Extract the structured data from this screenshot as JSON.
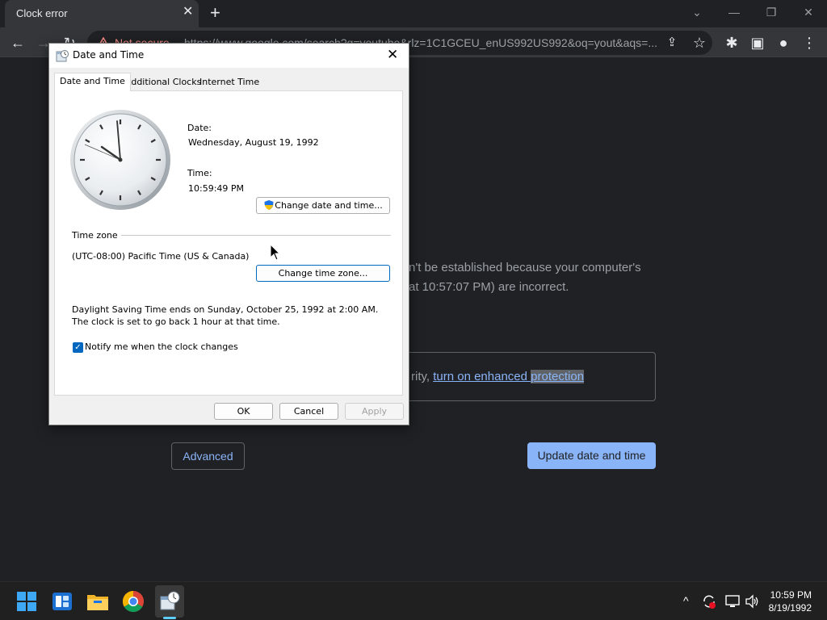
{
  "browser": {
    "tab_title": "Clock error",
    "tab_close": "✕",
    "new_tab": "+",
    "window_controls": {
      "chevron": "⌄",
      "minimize": "—",
      "restore": "❐",
      "close": "✕"
    },
    "toolbar": {
      "back": "←",
      "forward": "→",
      "reload": "↻",
      "security_label": "Not secure",
      "url": "https://www.google.com/search?q=youtube&rlz=1C1GCEU_enUS992US992&oq=yout&aqs=...",
      "share": "⇪",
      "star": "☆",
      "extensions": "✱",
      "sidebar": "▣",
      "profile": "●",
      "menu": "⋮"
    }
  },
  "error_page": {
    "message_line1": "n't be established because your computer's",
    "message_line2": "at 10:57:07 PM) are incorrect.",
    "protect_prefix": "rity, ",
    "protect_link": "turn on enhanced ",
    "protect_link2": "protection",
    "advanced_button": "Advanced",
    "update_button": "Update date and time"
  },
  "dialog": {
    "title": "Date and Time",
    "close": "✕",
    "tabs": [
      "Date and Time",
      "Additional Clocks",
      "Internet Time"
    ],
    "date_label": "Date:",
    "date_value": "Wednesday, August 19, 1992",
    "time_label": "Time:",
    "time_value": "10:59:49 PM",
    "change_datetime_button": "Change date and time...",
    "timezone_heading": "Time zone",
    "timezone_value": "(UTC-08:00) Pacific Time (US & Canada)",
    "change_timezone_button": "Change time zone...",
    "dst_text": "Daylight Saving Time ends on Sunday, October 25, 1992 at 2:00 AM. The clock is set to go back 1 hour at that time.",
    "notify_checked": true,
    "notify_label": "Notify me when the clock changes",
    "ok_button": "OK",
    "cancel_button": "Cancel",
    "apply_button": "Apply"
  },
  "taskbar": {
    "apps": [
      "start-icon",
      "widgets-icon",
      "file-explorer-icon",
      "chrome-icon",
      "date-time-app-icon"
    ],
    "tray_chevron": "^",
    "clock_time": "10:59 PM",
    "clock_date": "8/19/1992"
  },
  "colors": {
    "chrome_bg": "#202124",
    "link": "#8ab4f8",
    "dialog_bg": "#f0f0f0",
    "accent": "#0067c0"
  }
}
